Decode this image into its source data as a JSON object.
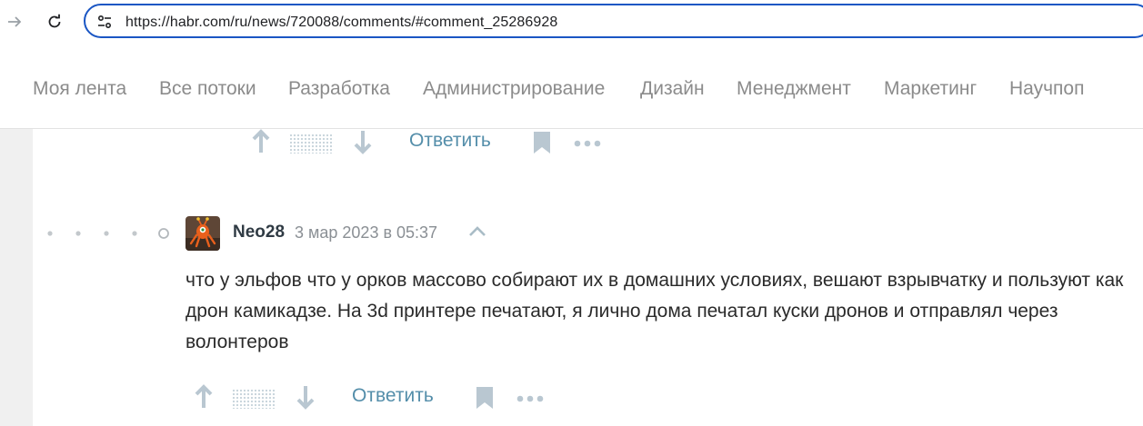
{
  "browser": {
    "url": "https://habr.com/ru/news/720088/comments/#comment_25286928"
  },
  "topnav": {
    "items": [
      "Моя лента",
      "Все потоки",
      "Разработка",
      "Администрирование",
      "Дизайн",
      "Менеджмент",
      "Маркетинг",
      "Научпоп"
    ]
  },
  "previous_comment": {
    "reply_label": "Ответить"
  },
  "comment": {
    "username": "Neo28",
    "date": "3 мар 2023 в 05:37",
    "text": "что у эльфов что у орков массово собирают их в домашних условиях, вешают взрывчатку и пользуют как дрон камикадзе. На 3d принтере печатают, я лично дома печатал куски дронов и отправлял через волонтеров",
    "reply_label": "Ответить"
  },
  "icons": {
    "back": "arrow-forward-icon",
    "reload": "reload-icon",
    "site_info": "tune-icon",
    "upvote": "arrow-up-icon",
    "downvote": "arrow-down-icon",
    "bookmark": "bookmark-icon",
    "more": "more-dots-icon",
    "parent": "chevron-up-icon"
  },
  "colors": {
    "accent_url_border": "#1a56c4",
    "reply_link": "#548eaa",
    "action_icons": "#b9c7d1",
    "nav_text": "#8b8b8b"
  }
}
